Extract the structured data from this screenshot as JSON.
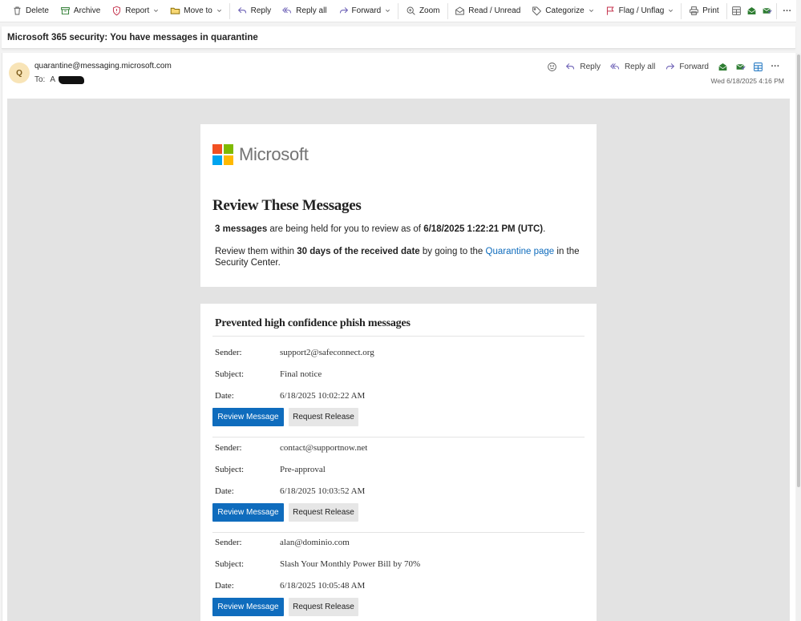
{
  "toolbar": {
    "delete": "Delete",
    "archive": "Archive",
    "report": "Report",
    "move_to": "Move to",
    "reply": "Reply",
    "reply_all": "Reply all",
    "forward": "Forward",
    "zoom": "Zoom",
    "read_unread": "Read / Unread",
    "categorize": "Categorize",
    "flag_unflag": "Flag / Unflag",
    "print": "Print",
    "more": "···"
  },
  "message": {
    "subject": "Microsoft 365 security: You have messages in quarantine",
    "avatar_initial": "Q",
    "from": "quarantine@messaging.microsoft.com",
    "to_label": "To:",
    "to_prefix": "A",
    "date": "Wed 6/18/2025 4:16 PM",
    "actions": {
      "reply": "Reply",
      "reply_all": "Reply all",
      "forward": "Forward",
      "more": "···"
    }
  },
  "email": {
    "logo_text": "Microsoft",
    "logo_colors": [
      "#f25022",
      "#7fba00",
      "#00a4ef",
      "#ffb900"
    ],
    "heading": "Review These Messages",
    "summary": {
      "count": "3 messages",
      "text1": " are being held for you to review as of ",
      "timestamp": "6/18/2025 1:22:21 PM (UTC)",
      "end": "."
    },
    "instructions": {
      "text1": "Review them within ",
      "window": "30 days of the received date",
      "text2": " by going to the ",
      "link": "Quarantine page",
      "text3": " in the Security Center."
    },
    "section_title": "Prevented high confidence phish messages",
    "labels": {
      "sender": "Sender:",
      "subject": "Subject:",
      "date": "Date:"
    },
    "buttons": {
      "review": "Review Message",
      "release": "Request Release"
    },
    "items": [
      {
        "sender": "support2@safeconnect.org",
        "subject": "Final notice",
        "date": "6/18/2025 10:02:22 AM"
      },
      {
        "sender": "contact@supportnow.net",
        "subject": "Pre-approval",
        "date": "6/18/2025 10:03:52 AM"
      },
      {
        "sender": "alan@dominio.com",
        "subject": "Slash Your Monthly Power Bill by 70%",
        "date": "6/18/2025 10:05:48 AM"
      }
    ]
  },
  "colors": {
    "accent": "#0f6cbd",
    "body_background": "#e3e3e3",
    "avatar_background": "#f8e4b7"
  }
}
